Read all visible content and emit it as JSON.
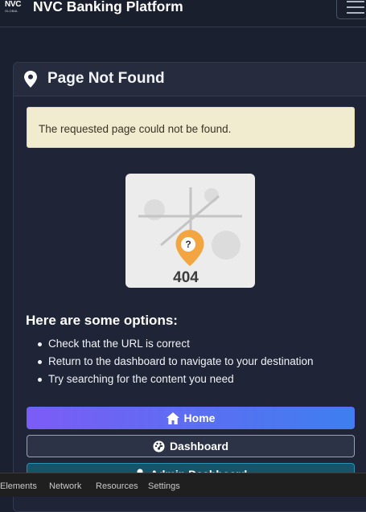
{
  "navbar": {
    "logo_line1": "NVC",
    "logo_line2": "GLOBAL",
    "brand": "NVC Banking Platform"
  },
  "icons": {
    "pin": "map-marker-icon",
    "home": "home-icon",
    "dashboard": "tachometer-icon",
    "admin": "user-icon",
    "menu": "hamburger-menu-icon"
  },
  "card": {
    "title": "Page Not Found",
    "alert_text": "The requested page could not be found.",
    "illustration_code": "404",
    "illustration_badge": "?",
    "options_title": "Here are some options:",
    "options": [
      "Check that the URL is correct",
      "Return to the dashboard to navigate to your destination",
      "Try searching for the content you need"
    ]
  },
  "buttons": {
    "home": "Home",
    "dashboard": "Dashboard",
    "admin": "Admin Dashboard"
  },
  "devtools": {
    "tabs": [
      "Elements",
      "Network",
      "Resources",
      "Settings"
    ]
  },
  "colors": {
    "page_bg": "#1b2030",
    "alert_bg": "#f1ebd0",
    "home_gradient_start": "#7c5cf6",
    "home_gradient_end": "#3d7fef",
    "admin_bg": "#16546a",
    "pin_orange": "#f2a540"
  }
}
